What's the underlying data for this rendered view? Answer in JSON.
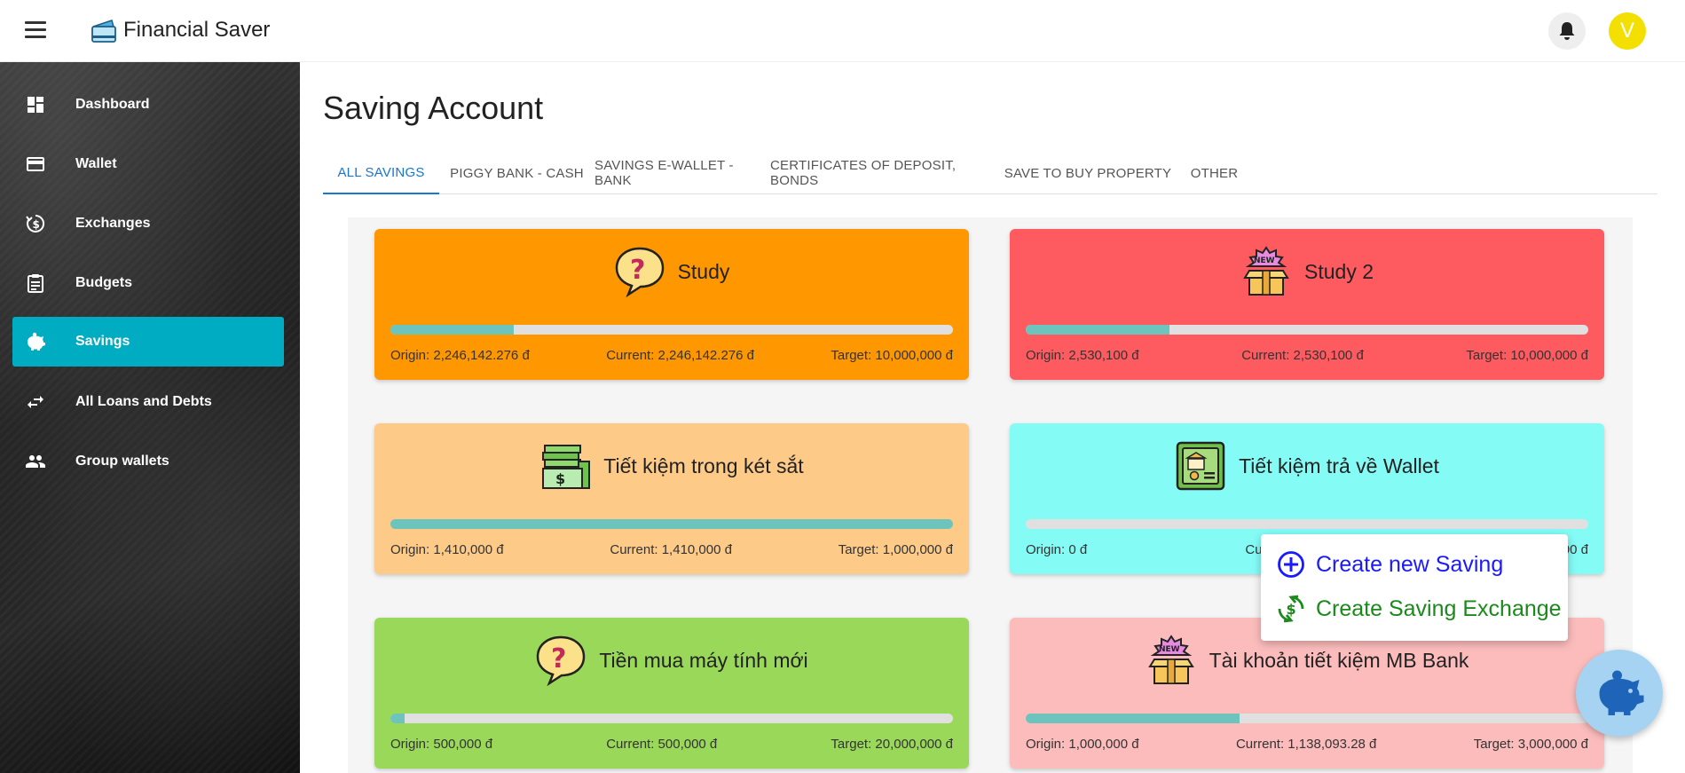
{
  "app": {
    "title": "Financial Saver"
  },
  "user": {
    "avatar_initial": "V",
    "avatar_color": "#f4e000"
  },
  "sidebar": {
    "items": [
      {
        "label": "Dashboard",
        "icon": "dashboard-icon"
      },
      {
        "label": "Wallet",
        "icon": "wallet-icon"
      },
      {
        "label": "Exchanges",
        "icon": "exchange-icon"
      },
      {
        "label": "Budgets",
        "icon": "clipboard-icon"
      },
      {
        "label": "Savings",
        "icon": "piggy-bank-icon",
        "active": true
      },
      {
        "label": "All Loans and Debts",
        "icon": "swap-arrows-icon"
      },
      {
        "label": "Group wallets",
        "icon": "people-icon"
      }
    ],
    "active_color": "#00acc1"
  },
  "page": {
    "title": "Saving Account"
  },
  "tabs": [
    {
      "label": "ALL SAVINGS",
      "active": true
    },
    {
      "label": "PIGGY BANK - CASH"
    },
    {
      "label": "SAVINGS E-WALLET - BANK"
    },
    {
      "label": "CERTIFICATES OF DEPOSIT, BONDS"
    },
    {
      "label": "SAVE TO BUY PROPERTY"
    },
    {
      "label": "OTHER"
    }
  ],
  "savings": [
    {
      "name": "Study",
      "icon": "question-bubble-icon",
      "color": "#ff9800",
      "progress": 0.22,
      "origin": "Origin: 2,246,142.276 đ",
      "current": "Current: 2,246,142.276 đ",
      "target": "Target: 10,000,000 đ"
    },
    {
      "name": "Study 2",
      "icon": "new-box-icon",
      "color": "#fe5b60",
      "progress": 0.255,
      "origin": "Origin: 2,530,100 đ",
      "current": "Current: 2,530,100 đ",
      "target": "Target: 10,000,000 đ"
    },
    {
      "name": "Tiết kiệm trong két sắt",
      "icon": "cash-stack-icon",
      "color": "#fdca88",
      "progress": 1.0,
      "origin": "Origin: 1,410,000 đ",
      "current": "Current: 1,410,000 đ",
      "target": "Target: 1,000,000 đ"
    },
    {
      "name": "Tiết kiệm trả về Wallet",
      "icon": "bank-card-icon",
      "color": "#85fbf6",
      "progress": 0.0,
      "origin": "Origin: 0 đ",
      "current": "Current: 0 đ",
      "target": "Target: 1,000,000 đ"
    },
    {
      "name": "Tiền mua máy tính mới",
      "icon": "question-bubble-icon",
      "color": "#9ad85a",
      "progress": 0.025,
      "origin": "Origin: 500,000 đ",
      "current": "Current: 500,000 đ",
      "target": "Target: 20,000,000 đ"
    },
    {
      "name": "Tài khoản tiết kiệm MB Bank",
      "icon": "new-box-icon",
      "color": "#fcbcbc",
      "progress": 0.38,
      "origin": "Origin: 1,000,000 đ",
      "current": "Current: 1,138,093.28 đ",
      "target": "Target: 3,000,000 đ"
    }
  ],
  "speed_dial": {
    "items": [
      {
        "label": "Create new Saving",
        "icon": "plus-circle-icon",
        "color": "#1a1aff"
      },
      {
        "label": "Create Saving Exchange",
        "icon": "exchange-dollar-icon",
        "color": "#1a8a1a"
      }
    ],
    "fab_icon": "piggy-bank-icon"
  }
}
